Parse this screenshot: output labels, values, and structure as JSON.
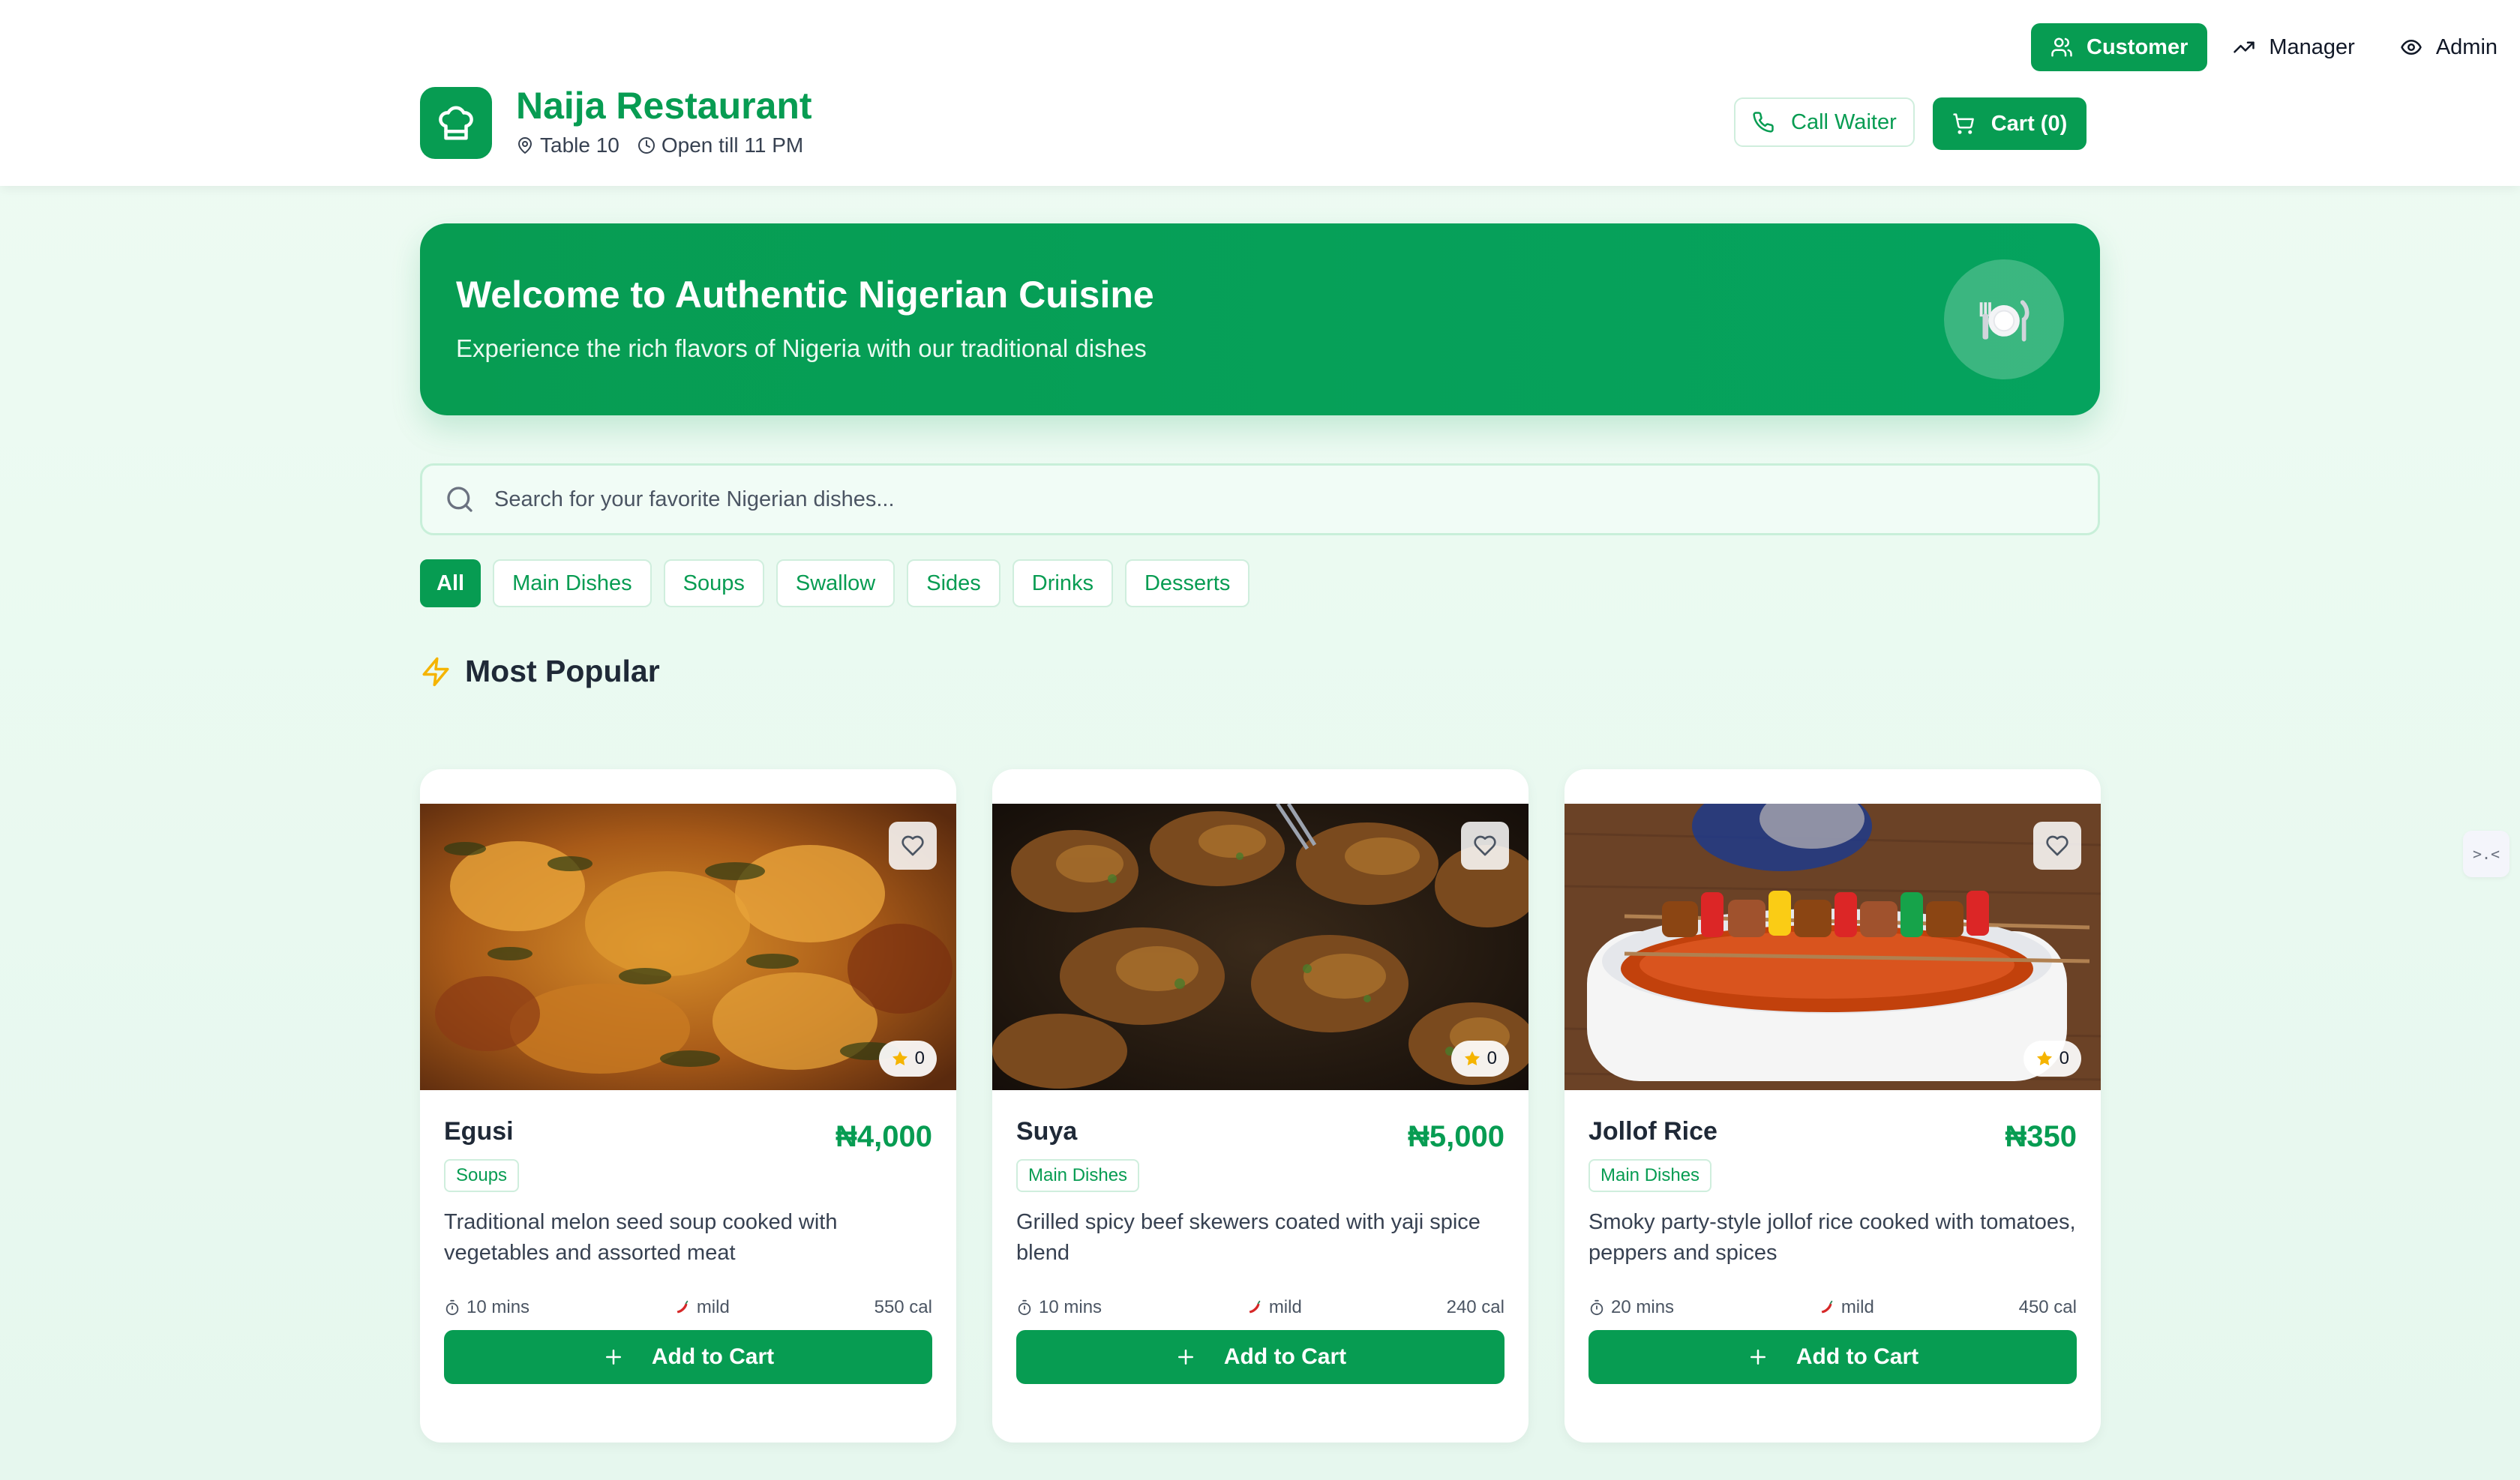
{
  "roles": [
    {
      "label": "Customer",
      "icon": "users-icon",
      "active": true
    },
    {
      "label": "Manager",
      "icon": "trending-up-icon",
      "active": false
    },
    {
      "label": "Admin",
      "icon": "eye-icon",
      "active": false
    }
  ],
  "header": {
    "name": "Naija Restaurant",
    "table": "Table 10",
    "hours": "Open till 11 PM",
    "call_waiter": "Call Waiter",
    "cart": "Cart (0)"
  },
  "hero": {
    "title": "Welcome to Authentic Nigerian Cuisine",
    "subtitle": "Experience the rich flavors of Nigeria with our traditional dishes",
    "icon": "plate-cutlery-icon"
  },
  "search": {
    "placeholder": "Search for your favorite Nigerian dishes...",
    "value": ""
  },
  "categories": [
    "All",
    "Main Dishes",
    "Soups",
    "Swallow",
    "Sides",
    "Drinks",
    "Desserts"
  ],
  "section": {
    "title": "Most Popular",
    "icon": "lightning-icon"
  },
  "dishes": [
    {
      "name": "Egusi",
      "price": "₦4,000",
      "category": "Soups",
      "description": "Traditional melon seed soup cooked with vegetables and assorted meat",
      "time": "10 mins",
      "spice": "mild",
      "calories": "550 cal",
      "rating": "0",
      "add_label": "Add to Cart"
    },
    {
      "name": "Suya",
      "price": "₦5,000",
      "category": "Main Dishes",
      "description": "Grilled spicy beef skewers coated with yaji spice blend",
      "time": "10 mins",
      "spice": "mild",
      "calories": "240 cal",
      "rating": "0",
      "add_label": "Add to Cart"
    },
    {
      "name": "Jollof Rice",
      "price": "₦350",
      "category": "Main Dishes",
      "description": "Smoky party-style jollof rice cooked with tomatoes, peppers and spices",
      "time": "20 mins",
      "spice": "mild",
      "calories": "450 cal",
      "rating": "0",
      "add_label": "Add to Cart"
    }
  ],
  "colors": {
    "brand": "#079c52",
    "star": "#f5b400"
  }
}
